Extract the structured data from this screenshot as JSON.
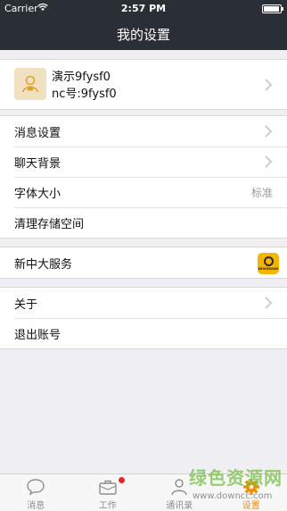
{
  "status_bar": {
    "carrier": "Carrier",
    "time": "2:57 PM",
    "wifi_icon": "wifi-icon",
    "battery_icon": "battery-icon"
  },
  "nav": {
    "title": "我的设置"
  },
  "profile": {
    "name": "演示9fysf0",
    "id": "nc号:9fysf0",
    "avatar_icon": "user-avatar-icon"
  },
  "settings": {
    "message_settings": "消息设置",
    "chat_background": "聊天背景",
    "font_size": "字体大小",
    "font_size_value": "标准",
    "clear_storage": "清理存储空间"
  },
  "service": {
    "label": "新中大服务",
    "logo_text": "NEWGRAND"
  },
  "about": {
    "label": "关于"
  },
  "logout": {
    "label": "退出账号"
  },
  "tabs": [
    {
      "label": "消息",
      "icon": "chat-bubble-icon"
    },
    {
      "label": "工作",
      "icon": "briefcase-icon",
      "badge": true
    },
    {
      "label": "通讯录",
      "icon": "contacts-icon"
    },
    {
      "label": "设置",
      "icon": "gear-icon",
      "active": true
    }
  ],
  "watermark": {
    "title": "绿色资源网",
    "url": "www.downcc.com"
  },
  "colors": {
    "nav_bg": "#2a2e35",
    "accent": "#f08c00",
    "badge": "#e8271e",
    "page_bg": "#efeff4"
  }
}
